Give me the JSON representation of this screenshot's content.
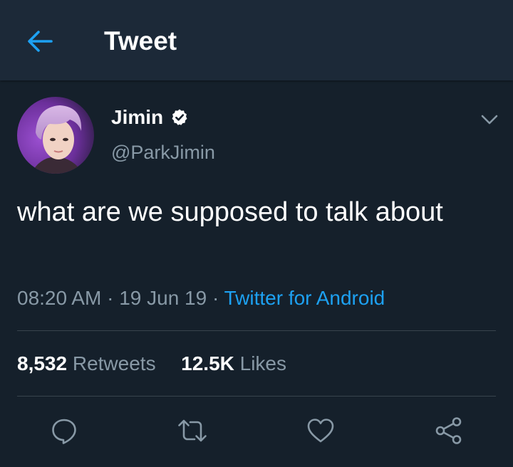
{
  "header": {
    "title": "Tweet",
    "back_icon": "arrow-left-icon"
  },
  "tweet": {
    "author": {
      "display_name": "Jimin",
      "handle": "@ParkJimin",
      "verified": true
    },
    "text": "what are we supposed to talk about",
    "time": "08:20 AM",
    "separator": " · ",
    "date": "19 Jun 19",
    "source": "Twitter for Android",
    "stats": {
      "retweets_count": "8,532",
      "retweets_label": "Retweets",
      "likes_count": "12.5K",
      "likes_label": "Likes"
    },
    "actions": [
      "reply-icon",
      "retweet-icon",
      "like-icon",
      "share-icon"
    ]
  },
  "colors": {
    "background": "#15202b",
    "header_background": "#1c2938",
    "accent": "#1da1f2",
    "secondary_text": "#8899a6",
    "divider": "#38444d",
    "icon": "#8899a6"
  }
}
